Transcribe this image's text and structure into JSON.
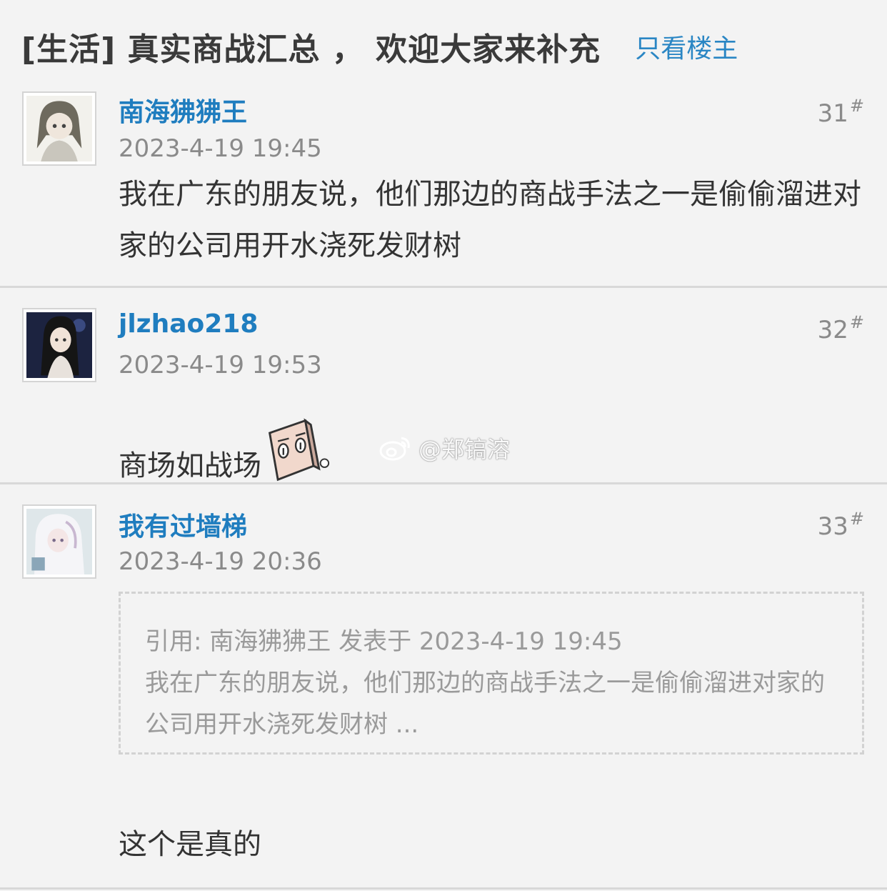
{
  "thread": {
    "title": "[生活] 真实商战汇总 ， 欢迎大家来补充",
    "only_op_label": "只看楼主"
  },
  "posts": [
    {
      "username": "南海狒狒王",
      "timestamp": "2023-4-19 19:45",
      "floor": "31",
      "floor_mark": "#",
      "content": "我在广东的朋友说，他们那边的商战手法之一是偷偷溜进对家的公司用开水浇死发财树"
    },
    {
      "username": "jlzhao218",
      "timestamp": "2023-4-19 19:53",
      "floor": "32",
      "floor_mark": "#",
      "content": "商场如战场",
      "emoji": "square-face-emoji"
    },
    {
      "username": "我有过墙梯",
      "timestamp": "2023-4-19 20:36",
      "floor": "33",
      "floor_mark": "#",
      "quote_header": "引用: 南海狒狒王 发表于 2023-4-19 19:45",
      "quote_text": "我在广东的朋友说，他们那边的商战手法之一是偷偷溜进对家的公司用开水浇死发财树 ...",
      "content": "这个是真的"
    }
  ],
  "watermark": {
    "text": "@郑镐溶",
    "icon": "weibo-icon"
  },
  "colors": {
    "background": "#f3f3f3",
    "username": "#1f7dbf",
    "link": "#2a86c4",
    "meta": "#8a8a8a",
    "quote_text": "#9a9a9a"
  }
}
